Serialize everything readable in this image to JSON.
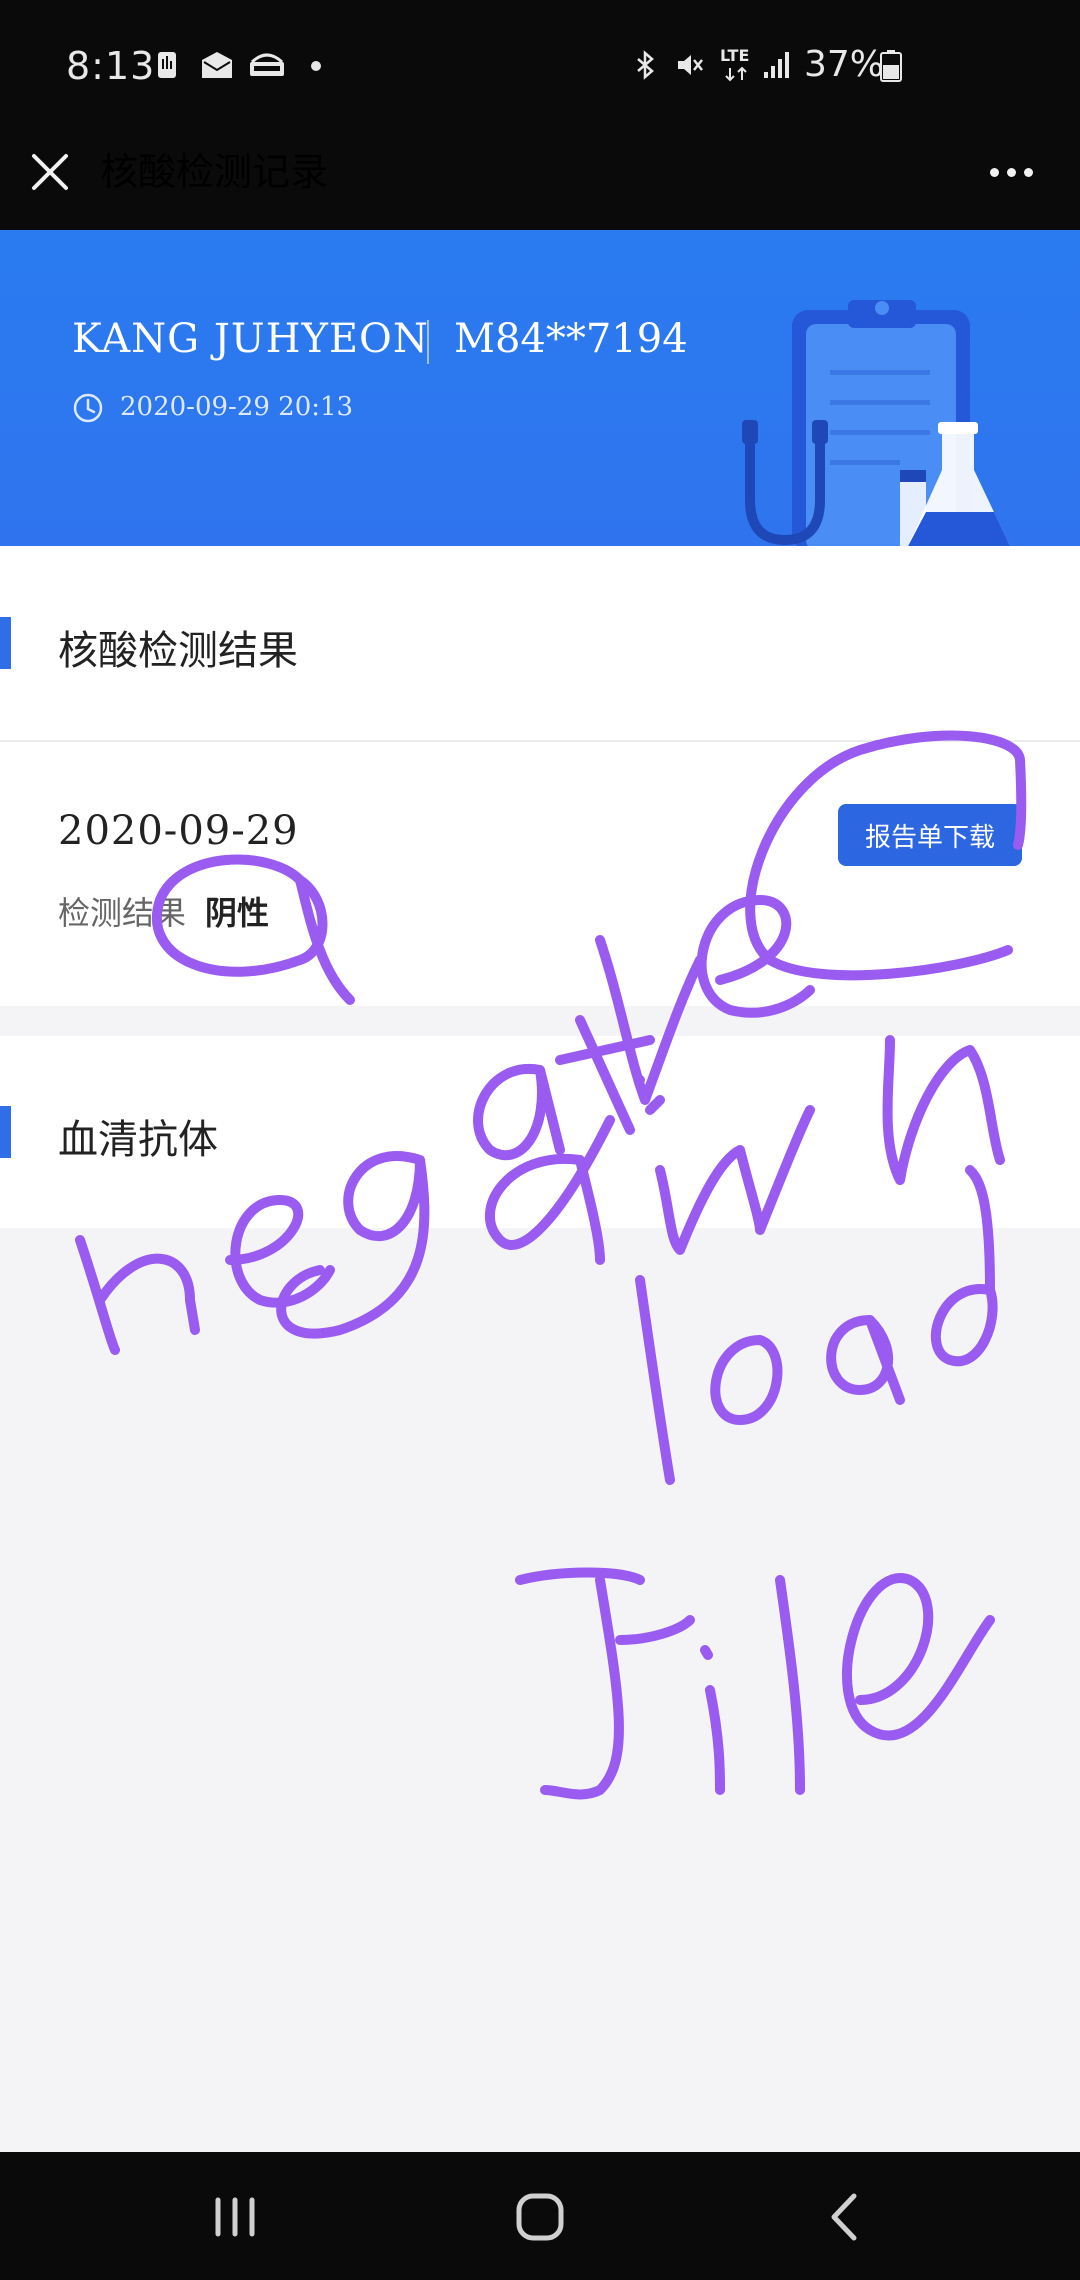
{
  "status_bar": {
    "time": "8:13",
    "network": "LTE",
    "battery": "37%",
    "icons": [
      "sim-app-icon",
      "mail-icon",
      "basket-icon",
      "bluetooth-icon",
      "mute-icon",
      "lte-icon",
      "signal-icon",
      "battery-icon"
    ]
  },
  "header": {
    "title": "核酸检测记录",
    "close_icon": "close-icon",
    "more_icon": "more-icon"
  },
  "banner": {
    "name": "KANG JUHYEON",
    "id": "M84**7194",
    "datetime": "2020-09-29 20:13",
    "colors": {
      "background": "#2f74ee"
    }
  },
  "nucleic_section": {
    "title": "核酸检测结果",
    "date": "2020-09-29",
    "result_label": "检测结果",
    "result_value": "阴性",
    "download_label": "报告单下载"
  },
  "serum_section": {
    "title": "血清抗体"
  },
  "handwriting": {
    "text": "negative download file",
    "color": "#9a5bf0"
  },
  "nav_bar": {
    "buttons": [
      "recent-apps-icon",
      "home-icon",
      "back-icon"
    ]
  }
}
